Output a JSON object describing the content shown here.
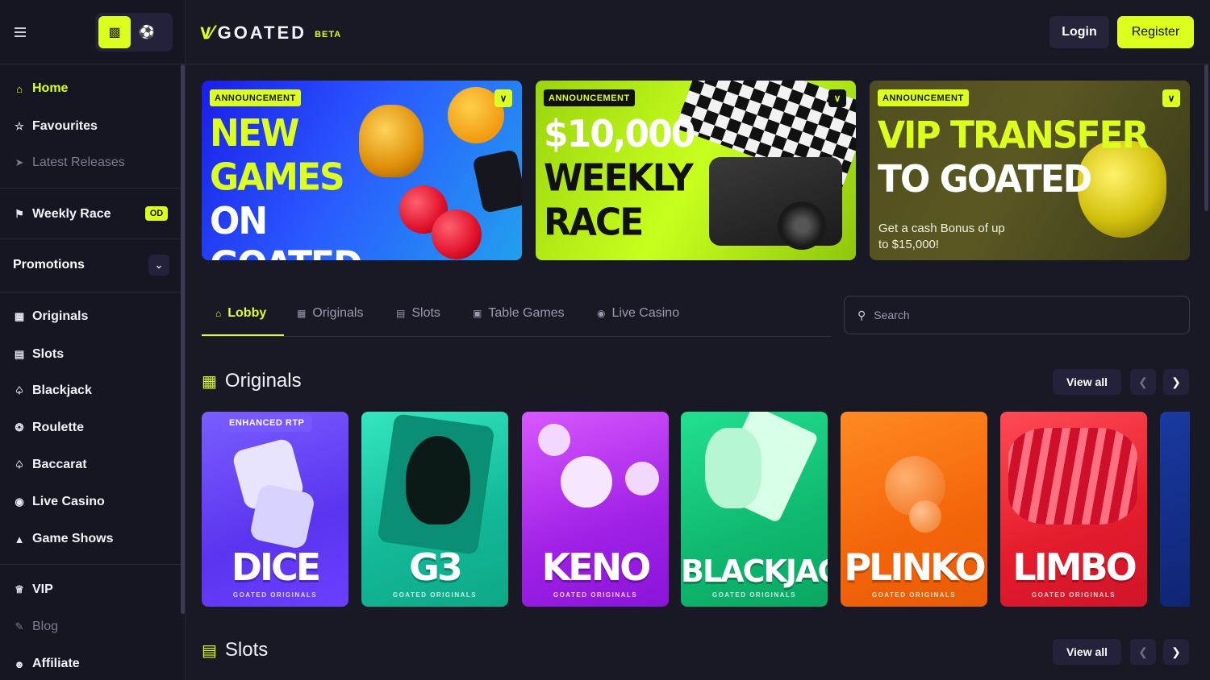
{
  "header": {
    "logo_text": "GOATED",
    "logo_badge": "BETA",
    "login_label": "Login",
    "register_label": "Register"
  },
  "sidebar": {
    "items": [
      {
        "label": "Home",
        "icon": "home-icon"
      },
      {
        "label": "Favourites",
        "icon": "star-icon"
      },
      {
        "label": "Latest Releases",
        "icon": "rocket-icon"
      },
      {
        "label": "Weekly Race",
        "icon": "trophy-icon",
        "badge": "OD"
      },
      {
        "label": "Promotions",
        "icon": "chevron-down-icon"
      },
      {
        "label": "Originals",
        "icon": "originals-icon"
      },
      {
        "label": "Slots",
        "icon": "slots-icon"
      },
      {
        "label": "Blackjack",
        "icon": "spade-icon"
      },
      {
        "label": "Roulette",
        "icon": "roulette-icon"
      },
      {
        "label": "Baccarat",
        "icon": "spade-icon"
      },
      {
        "label": "Live Casino",
        "icon": "live-icon"
      },
      {
        "label": "Game Shows",
        "icon": "game-shows-icon"
      },
      {
        "label": "VIP",
        "icon": "crown-icon"
      },
      {
        "label": "Blog",
        "icon": "blog-icon"
      },
      {
        "label": "Affiliate",
        "icon": "affiliate-icon"
      }
    ]
  },
  "banners": [
    {
      "tag": "ANNOUNCEMENT",
      "line1": "NEW",
      "line2": "GAMES",
      "line3": "ON GOATED"
    },
    {
      "tag": "ANNOUNCEMENT",
      "line1": "$10,000",
      "line2": "WEEKLY",
      "line3": "RACE"
    },
    {
      "tag": "ANNOUNCEMENT",
      "line1": "VIP TRANSFER",
      "line2": "TO GOATED",
      "sub": "Get a cash Bonus of up to $15,000!"
    }
  ],
  "tabs": [
    {
      "label": "Lobby"
    },
    {
      "label": "Originals"
    },
    {
      "label": "Slots"
    },
    {
      "label": "Table Games"
    },
    {
      "label": "Live Casino"
    }
  ],
  "search": {
    "placeholder": "Search"
  },
  "sections": {
    "originals": {
      "title": "Originals",
      "view_all": "View all"
    },
    "slots": {
      "title": "Slots",
      "view_all": "View all"
    }
  },
  "games": [
    {
      "name": "DICE",
      "sub": "GOATED ORIGINALS",
      "tag": "ENHANCED RTP"
    },
    {
      "name": "G3",
      "sub": "GOATED ORIGINALS"
    },
    {
      "name": "KENO",
      "sub": "GOATED ORIGINALS"
    },
    {
      "name": "BLACKJACK",
      "sub": "GOATED ORIGINALS"
    },
    {
      "name": "PLINKO",
      "sub": "GOATED ORIGINALS"
    },
    {
      "name": "LIMBO",
      "sub": "GOATED ORIGINALS"
    }
  ],
  "colors": {
    "accent": "#dcff1e",
    "background": "#191926",
    "sidebar": "#161622"
  }
}
